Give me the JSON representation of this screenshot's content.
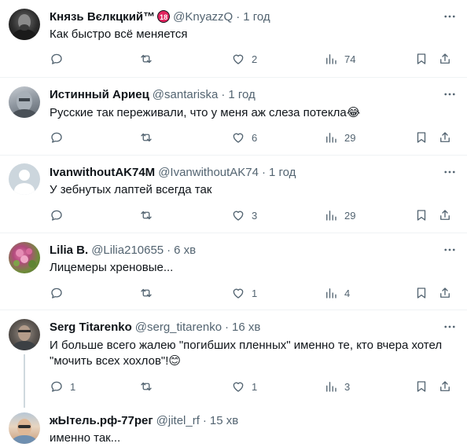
{
  "tweets": [
    {
      "name": "Князь Вєлкцкий™",
      "badge": "18",
      "handle": "@KnyazzQ",
      "time": "1 год",
      "text": "Как быстро всё меняется",
      "reply_count": "",
      "retweet_count": "",
      "like_count": "2",
      "view_count": "74"
    },
    {
      "name": "Истинный Ариец",
      "handle": "@santariska",
      "time": "1 год",
      "text": "Русские так переживали, что у меня аж слеза потекла😂",
      "reply_count": "",
      "retweet_count": "",
      "like_count": "6",
      "view_count": "29"
    },
    {
      "name": "IvanwithoutAK74M",
      "handle": "@IvanwithoutAK74",
      "time": "1 год",
      "text": "У зебнутых лаптей всегда так",
      "reply_count": "",
      "retweet_count": "",
      "like_count": "3",
      "view_count": "29"
    },
    {
      "name": "Lilia B.",
      "handle": "@Lilia210655",
      "time": "6 хв",
      "text": "Лицемеры хреновые...",
      "reply_count": "",
      "retweet_count": "",
      "like_count": "1",
      "view_count": "4"
    },
    {
      "name": "Serg Titarenko",
      "handle": "@serg_titarenko",
      "time": "16 хв",
      "text": "И больше всего жалею \"погибших пленных\" именно те, кто вчера хотел \"мочить всех хохлов\"!😊",
      "reply_count": "1",
      "retweet_count": "",
      "like_count": "1",
      "view_count": "3"
    },
    {
      "name": "жЫтель.рф-77рег",
      "handle": "@jitel_rf",
      "time": "15 хв",
      "text": "именно так..."
    }
  ],
  "colors": {
    "text": "#0f1419",
    "secondary": "#536471",
    "divider": "#eff3f4",
    "thread_line": "#cfd9de",
    "badge": "#e0245e"
  },
  "icons": [
    "reply-icon",
    "retweet-icon",
    "like-icon",
    "views-icon",
    "bookmark-icon",
    "share-icon",
    "more-icon"
  ]
}
